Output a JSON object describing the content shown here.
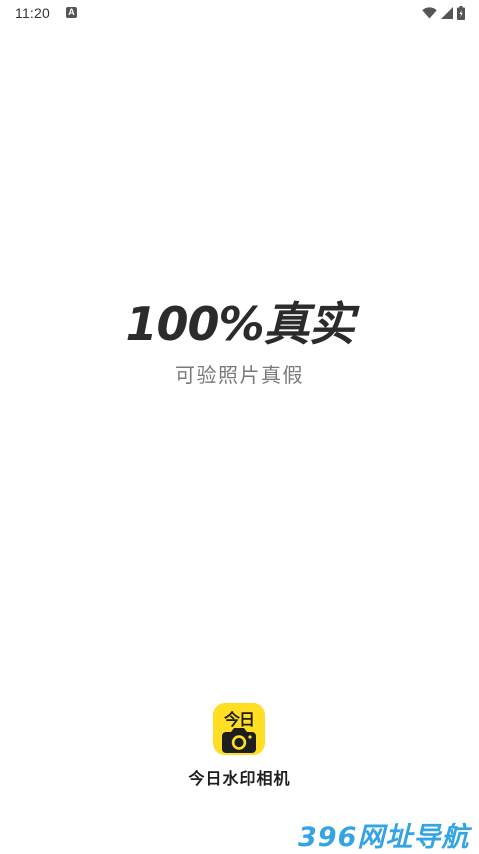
{
  "status_bar": {
    "time": "11:20",
    "notification_icon": "a-icon",
    "icons": [
      "wifi-icon",
      "signal-icon",
      "battery-icon"
    ]
  },
  "splash": {
    "headline": "100%真实",
    "subline": "可验照片真假"
  },
  "app": {
    "logo_text": "今日",
    "name": "今日水印相机",
    "brand_color": "#ffde24"
  },
  "watermark": {
    "text": "396网址导航"
  }
}
